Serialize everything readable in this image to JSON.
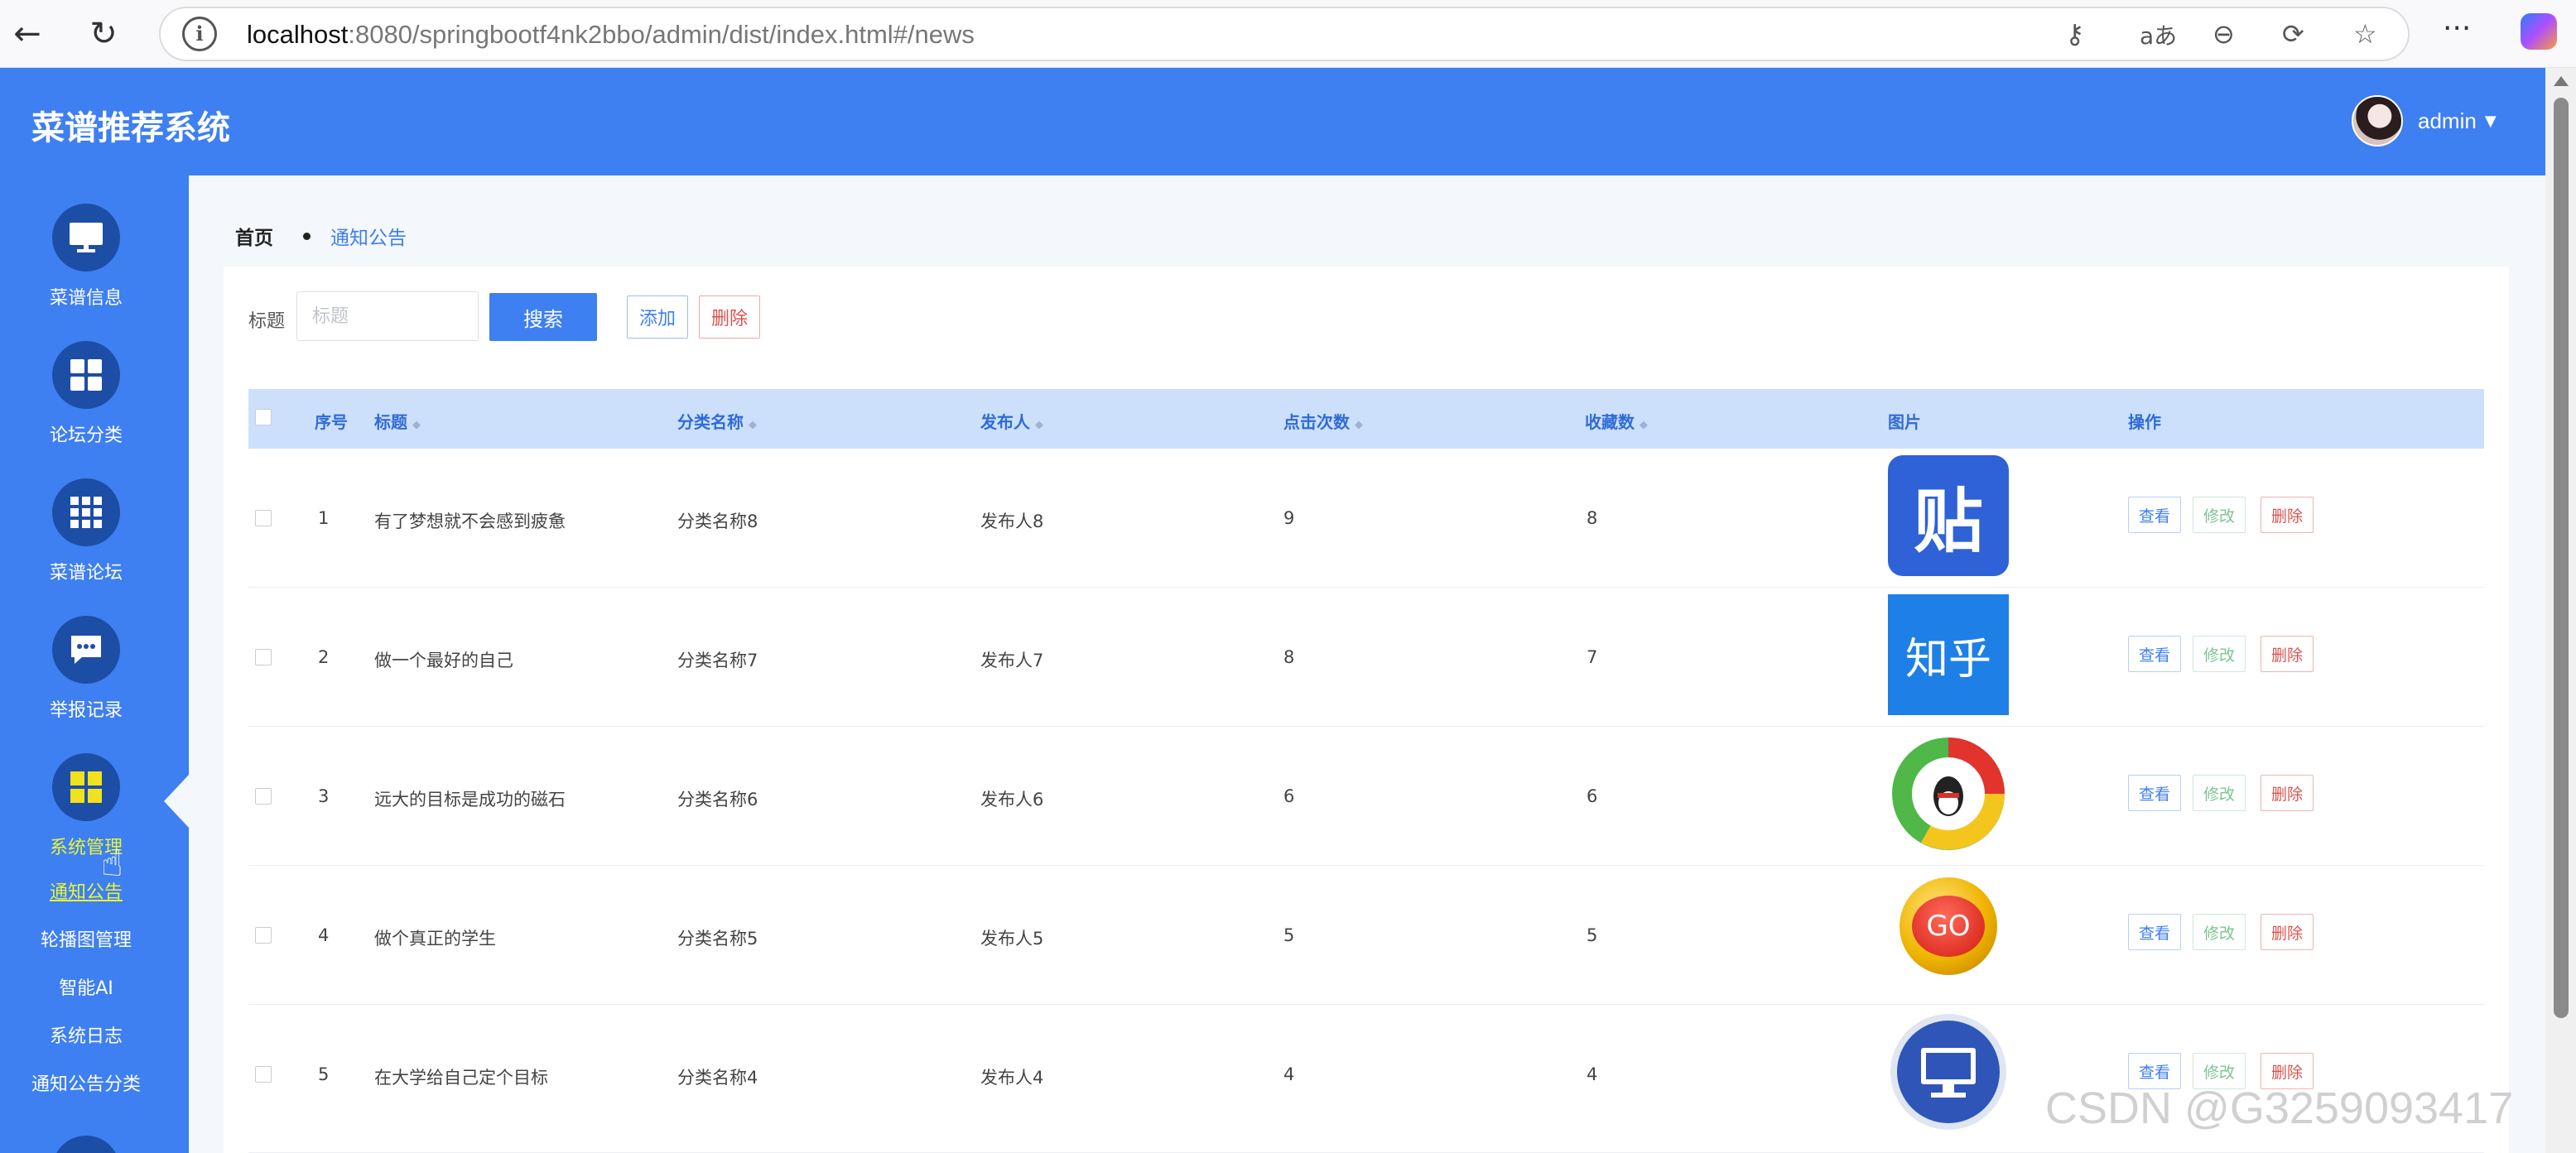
{
  "browser": {
    "url_host": "localhost",
    "url_rest": ":8080/springbootf4nk2bbo/admin/dist/index.html#/news"
  },
  "app": {
    "title": "菜谱推荐系统",
    "user": "admin"
  },
  "sidebar": {
    "items": [
      {
        "label": "菜谱信息",
        "icon": "monitor-icon"
      },
      {
        "label": "论坛分类",
        "icon": "grid-icon"
      },
      {
        "label": "菜谱论坛",
        "icon": "apps-icon"
      },
      {
        "label": "举报记录",
        "icon": "chat-icon"
      },
      {
        "label": "系统管理",
        "icon": "tiles-icon"
      }
    ],
    "sub_items": [
      "通知公告",
      "轮播图管理",
      "智能AI",
      "系统日志",
      "通知公告分类"
    ]
  },
  "breadcrumb": {
    "home": "首页",
    "current": "通知公告"
  },
  "search": {
    "label": "标题",
    "placeholder": "标题",
    "search_button": "搜索",
    "add_button": "添加",
    "delete_button": "删除"
  },
  "table": {
    "headers": {
      "index": "序号",
      "title": "标题",
      "category": "分类名称",
      "publisher": "发布人",
      "clicks": "点击次数",
      "favorites": "收藏数",
      "image": "图片",
      "actions": "操作"
    },
    "rows": [
      {
        "index": "1",
        "title": "有了梦想就不会感到疲惫",
        "category": "分类名称8",
        "publisher": "发布人8",
        "clicks": "9",
        "favorites": "8",
        "image": "tieba-logo",
        "image_text": "贴"
      },
      {
        "index": "2",
        "title": "做一个最好的自己",
        "category": "分类名称7",
        "publisher": "发布人7",
        "clicks": "8",
        "favorites": "7",
        "image": "zhihu-logo",
        "image_text": "知乎"
      },
      {
        "index": "3",
        "title": "远大的目标是成功的磁石",
        "category": "分类名称6",
        "publisher": "发布人6",
        "clicks": "6",
        "favorites": "6",
        "image": "qq-logo",
        "image_text": ""
      },
      {
        "index": "4",
        "title": "做个真正的学生",
        "category": "分类名称5",
        "publisher": "发布人5",
        "clicks": "5",
        "favorites": "5",
        "image": "go-logo",
        "image_text": "GO"
      },
      {
        "index": "5",
        "title": "在大学给自己定个目标",
        "category": "分类名称4",
        "publisher": "发布人4",
        "clicks": "4",
        "favorites": "4",
        "image": "computer-logo",
        "image_text": ""
      }
    ],
    "row_actions": {
      "view": "查看",
      "edit": "修改",
      "delete": "删除"
    }
  },
  "watermark": "CSDN @G3259093417",
  "colors": {
    "primary": "#3e7ff2",
    "sidebar_icon_bg": "#1d4ea5",
    "active_menu": "#e8f536",
    "danger": "#d9534f",
    "success": "#7cc493"
  }
}
